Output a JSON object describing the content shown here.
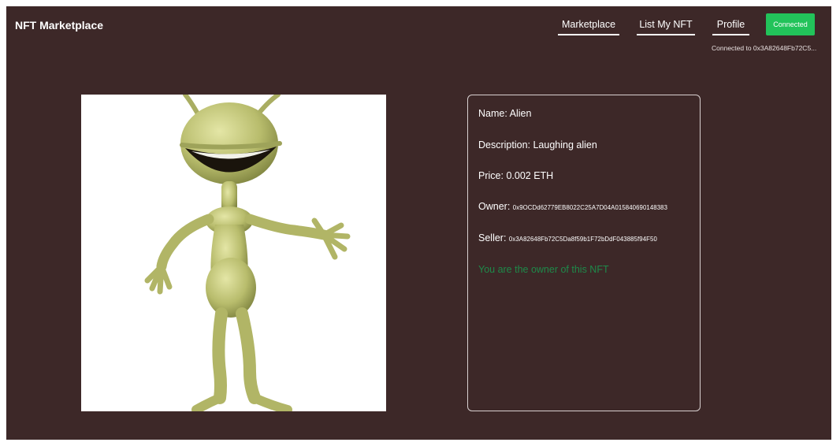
{
  "header": {
    "brand": "NFT Marketplace",
    "nav": {
      "marketplace": "Marketplace",
      "list": "List My NFT",
      "profile": "Profile"
    },
    "connect_button": "Connected",
    "connected_to": "Connected to 0x3A82648Fb72C5..."
  },
  "nft": {
    "name_label": "Name: ",
    "name": "Alien",
    "description_label": "Description: ",
    "description": "Laughing alien",
    "price_label": "Price: ",
    "price": "0.002 ETH",
    "owner_label": "Owner: ",
    "owner": "0x9OCDd62779EB8022C25A7D04A015840690148383",
    "seller_label": "Seller: ",
    "seller": "0x3A82648Fb72C5Da8f59b1F72bDdF043885f94F50",
    "status": "You are the owner of this NFT"
  },
  "colors": {
    "background": "#3d2828",
    "accent_green": "#22c35a",
    "status_green": "#1e8a4a"
  },
  "icons": {
    "nft_image": "alien-figure-image"
  }
}
